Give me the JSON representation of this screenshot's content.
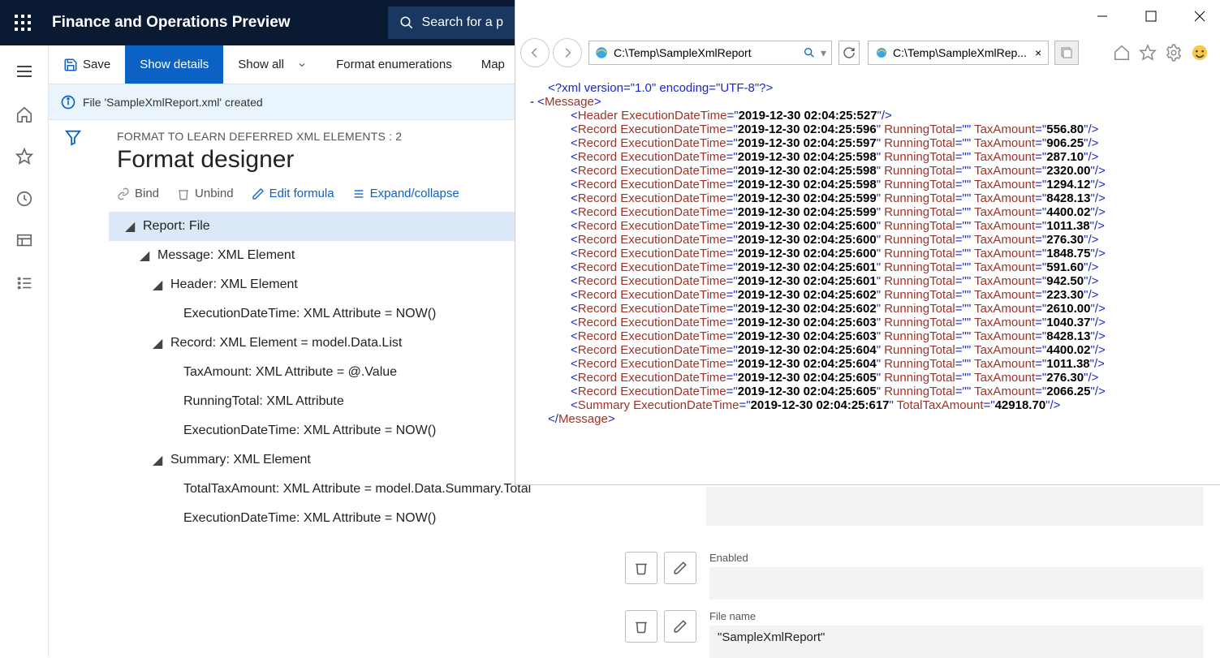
{
  "topbar": {
    "title": "Finance and Operations Preview",
    "search_placeholder": "Search for a p"
  },
  "cmd": {
    "save": "Save",
    "show_details": "Show details",
    "show_all": "Show all",
    "format_enum": "Format enumerations",
    "map": "Map"
  },
  "info": {
    "msg": "File 'SampleXmlReport.xml' created"
  },
  "page": {
    "breadcrumb": "FORMAT TO LEARN DEFERRED XML ELEMENTS : 2",
    "title": "Format designer",
    "toolbar": {
      "bind": "Bind",
      "unbind": "Unbind",
      "edit": "Edit formula",
      "expand": "Expand/collapse"
    },
    "tree": [
      "Report: File",
      "Message: XML Element",
      "Header: XML Element",
      "ExecutionDateTime: XML Attribute = NOW()",
      "Record: XML Element = model.Data.List",
      "TaxAmount: XML Attribute = @.Value",
      "RunningTotal: XML Attribute",
      "ExecutionDateTime: XML Attribute = NOW()",
      "Summary: XML Element",
      "TotalTaxAmount: XML Attribute = model.Data.Summary.Total",
      "ExecutionDateTime: XML Attribute = NOW()"
    ]
  },
  "props": {
    "enabled_label": "Enabled",
    "filename_label": "File name",
    "filename_value": "\"SampleXmlReport\""
  },
  "ie": {
    "address": "C:\\Temp\\SampleXmlReport",
    "tab": "C:\\Temp\\SampleXmlRep...",
    "xml": {
      "decl": "<?xml version=\"1.0\" encoding=\"UTF-8\"?>",
      "root_open": "Message",
      "header_time": "2019-12-30 02:04:25:527",
      "records": [
        {
          "t": "2019-12-30 02:04:25:596",
          "amt": "556.80"
        },
        {
          "t": "2019-12-30 02:04:25:597",
          "amt": "906.25"
        },
        {
          "t": "2019-12-30 02:04:25:598",
          "amt": "287.10"
        },
        {
          "t": "2019-12-30 02:04:25:598",
          "amt": "2320.00"
        },
        {
          "t": "2019-12-30 02:04:25:598",
          "amt": "1294.12"
        },
        {
          "t": "2019-12-30 02:04:25:599",
          "amt": "8428.13"
        },
        {
          "t": "2019-12-30 02:04:25:599",
          "amt": "4400.02"
        },
        {
          "t": "2019-12-30 02:04:25:600",
          "amt": "1011.38"
        },
        {
          "t": "2019-12-30 02:04:25:600",
          "amt": "276.30"
        },
        {
          "t": "2019-12-30 02:04:25:600",
          "amt": "1848.75"
        },
        {
          "t": "2019-12-30 02:04:25:601",
          "amt": "591.60"
        },
        {
          "t": "2019-12-30 02:04:25:601",
          "amt": "942.50"
        },
        {
          "t": "2019-12-30 02:04:25:602",
          "amt": "223.30"
        },
        {
          "t": "2019-12-30 02:04:25:602",
          "amt": "2610.00"
        },
        {
          "t": "2019-12-30 02:04:25:603",
          "amt": "1040.37"
        },
        {
          "t": "2019-12-30 02:04:25:603",
          "amt": "8428.13"
        },
        {
          "t": "2019-12-30 02:04:25:604",
          "amt": "4400.02"
        },
        {
          "t": "2019-12-30 02:04:25:604",
          "amt": "1011.38"
        },
        {
          "t": "2019-12-30 02:04:25:605",
          "amt": "276.30"
        },
        {
          "t": "2019-12-30 02:04:25:605",
          "amt": "2066.25"
        }
      ],
      "summary_time": "2019-12-30 02:04:25:617",
      "summary_total": "42918.70"
    }
  }
}
